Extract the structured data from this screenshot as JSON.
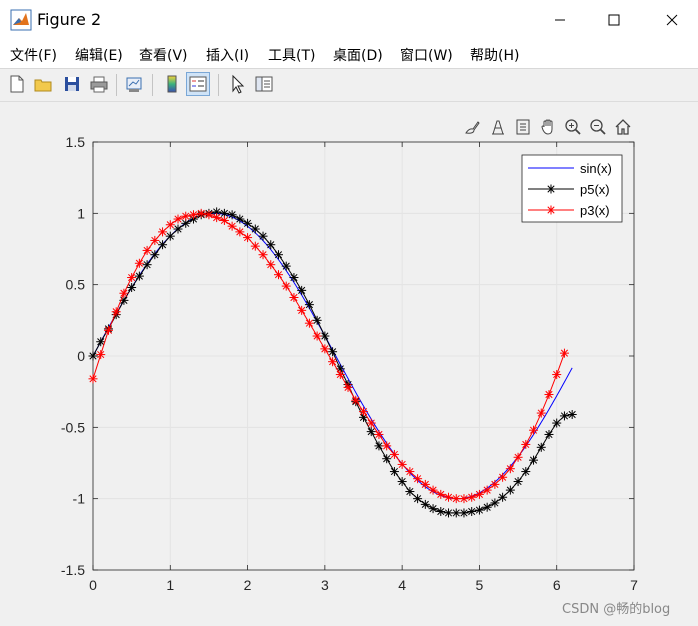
{
  "window": {
    "title": "Figure 2"
  },
  "menu": [
    "文件(F)",
    "编辑(E)",
    "查看(V)",
    "插入(I)",
    "工具(T)",
    "桌面(D)",
    "窗口(W)",
    "帮助(H)"
  ],
  "toolbar": {
    "items": [
      "new-figure-icon",
      "open-file-icon",
      "save-icon",
      "print-icon",
      "link-plot-icon",
      "colorbar-icon",
      "legend-icon",
      "pointer-icon",
      "property-inspector-icon"
    ],
    "active": "legend-icon"
  },
  "axes_toolbar": [
    "brush-icon",
    "data-tips-icon",
    "export-icon",
    "pan-icon",
    "zoom-in-icon",
    "zoom-out-icon",
    "home-icon"
  ],
  "colors": {
    "sin": "#0000ff",
    "p5": "#000000",
    "p3": "#ff0000"
  },
  "watermark": "CSDN @畅的blog",
  "chart_data": {
    "type": "line",
    "title": "",
    "xlabel": "",
    "ylabel": "",
    "xlim": [
      0,
      7
    ],
    "ylim": [
      -1.5,
      1.5
    ],
    "xticks": [
      "0",
      "1",
      "2",
      "3",
      "4",
      "5",
      "6",
      "7"
    ],
    "yticks": [
      "1.5",
      "1",
      "0.5",
      "0",
      "-0.5",
      "-1",
      "-1.5"
    ],
    "grid": true,
    "legend_position": "top-right",
    "x_step": 0.1,
    "x_start": 0,
    "series": [
      {
        "name": "sin(x)",
        "color": "#0000ff",
        "marker": "none",
        "x_range": [
          0,
          6.2
        ]
      },
      {
        "name": "p5(x)",
        "color": "#000000",
        "marker": "asterisk",
        "x_range": [
          0,
          6.2
        ],
        "y": [
          0.0,
          0.1,
          0.19,
          0.29,
          0.39,
          0.48,
          0.56,
          0.64,
          0.71,
          0.78,
          0.84,
          0.89,
          0.93,
          0.96,
          0.99,
          1.0,
          1.01,
          1.0,
          0.99,
          0.96,
          0.93,
          0.89,
          0.84,
          0.78,
          0.71,
          0.63,
          0.55,
          0.46,
          0.36,
          0.25,
          0.14,
          0.03,
          -0.09,
          -0.2,
          -0.32,
          -0.43,
          -0.53,
          -0.63,
          -0.72,
          -0.81,
          -0.88,
          -0.95,
          -1.0,
          -1.04,
          -1.07,
          -1.09,
          -1.1,
          -1.1,
          -1.1,
          -1.09,
          -1.08,
          -1.06,
          -1.03,
          -0.99,
          -0.94,
          -0.88,
          -0.81,
          -0.73,
          -0.64,
          -0.55,
          -0.47,
          -0.42,
          -0.41
        ]
      },
      {
        "name": "p3(x)",
        "color": "#ff0000",
        "marker": "asterisk",
        "x_range": [
          0,
          6.2
        ],
        "y": [
          -0.16,
          0.01,
          0.18,
          0.31,
          0.44,
          0.55,
          0.65,
          0.74,
          0.81,
          0.87,
          0.92,
          0.96,
          0.98,
          0.99,
          1.0,
          0.99,
          0.97,
          0.95,
          0.91,
          0.87,
          0.83,
          0.77,
          0.71,
          0.64,
          0.57,
          0.49,
          0.41,
          0.32,
          0.23,
          0.14,
          0.05,
          -0.04,
          -0.13,
          -0.22,
          -0.31,
          -0.39,
          -0.47,
          -0.55,
          -0.63,
          -0.69,
          -0.76,
          -0.81,
          -0.86,
          -0.9,
          -0.94,
          -0.97,
          -0.99,
          -1.0,
          -1.0,
          -0.99,
          -0.97,
          -0.94,
          -0.9,
          -0.85,
          -0.79,
          -0.71,
          -0.62,
          -0.52,
          -0.4,
          -0.27,
          -0.13,
          0.02
        ]
      }
    ]
  }
}
